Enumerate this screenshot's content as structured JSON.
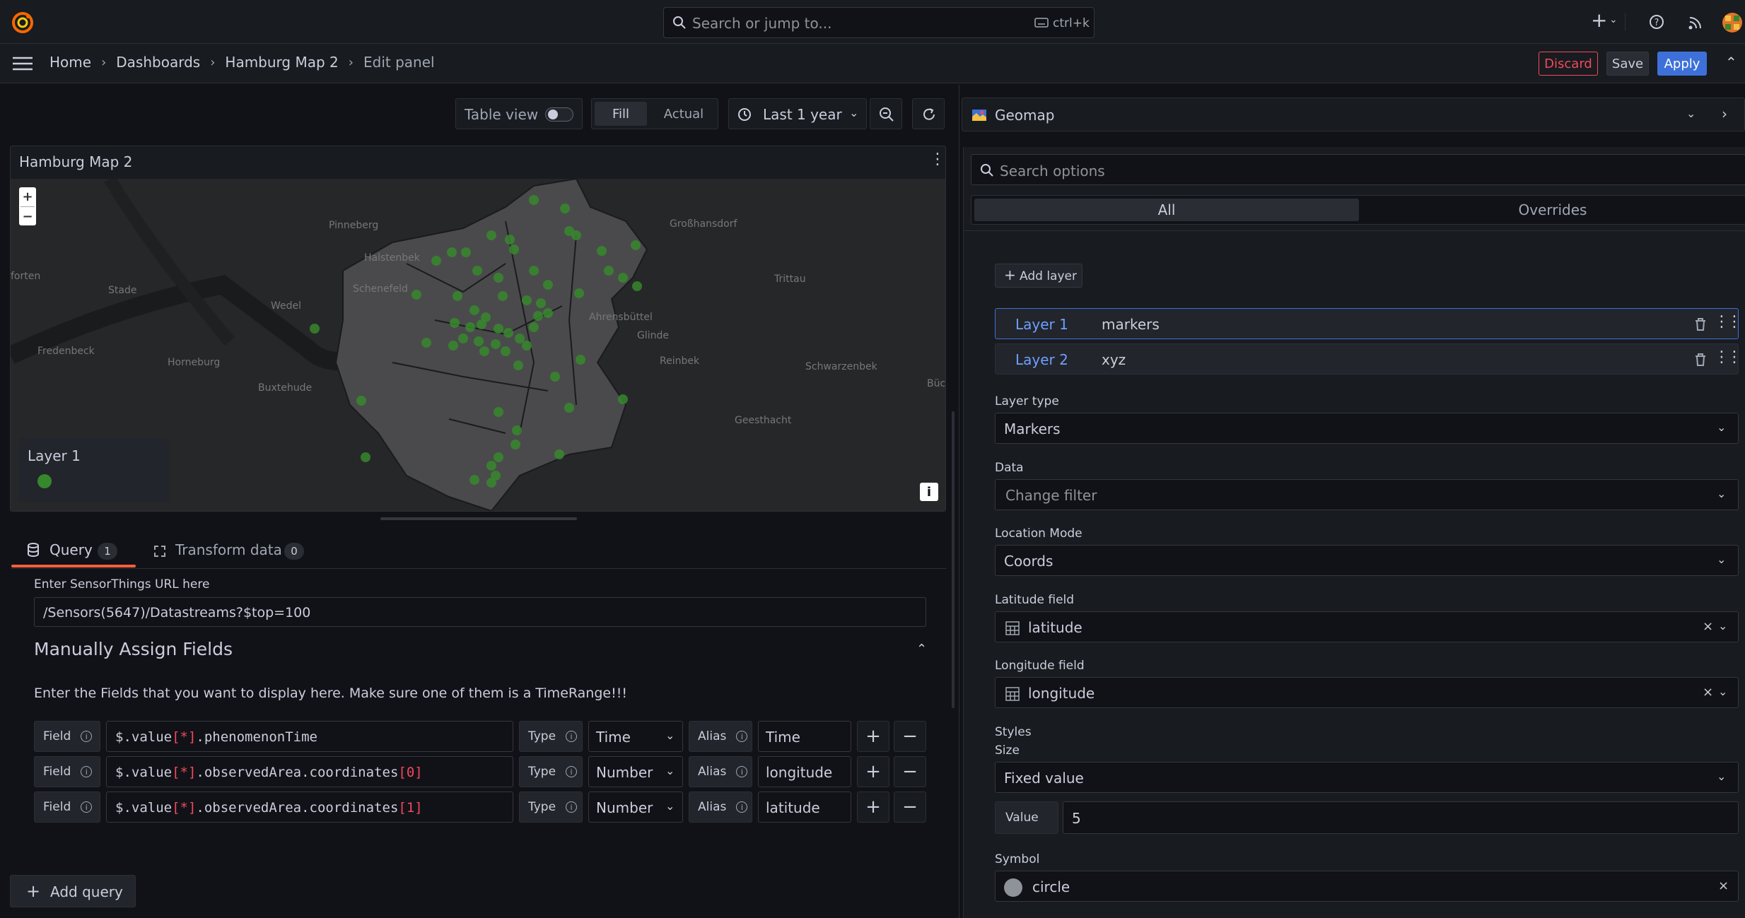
{
  "topbar": {
    "search_placeholder": "Search or jump to...",
    "search_shortcut": "ctrl+k"
  },
  "breadcrumb": {
    "items": [
      "Home",
      "Dashboards",
      "Hamburg Map 2",
      "Edit panel"
    ]
  },
  "actions": {
    "discard": "Discard",
    "save": "Save",
    "apply": "Apply"
  },
  "toolbar": {
    "table_view": "Table view",
    "fill": "Fill",
    "actual": "Actual",
    "time_range": "Last 1 year"
  },
  "panel": {
    "title": "Hamburg Map 2",
    "zoom_in": "+",
    "zoom_out": "−",
    "legend_title": "Layer 1",
    "info": "i",
    "places": [
      "Pinneberg",
      "Halstenbek",
      "Schenefeld",
      "Stade",
      "Wedel",
      "forten",
      "Großhansdorf",
      "Trittau",
      "Glinde",
      "Reinbek",
      "Schwarzenbek",
      "Buxtehude",
      "Horneburg",
      "Fredenbeck",
      "Geesthacht",
      "Bück",
      "Ahrensbüttel"
    ]
  },
  "query_tabs": {
    "query": "Query",
    "query_count": "1",
    "transform": "Transform data",
    "transform_count": "0"
  },
  "query": {
    "url_label": "Enter SensorThings URL here",
    "url_value": "/Sensors(5647)/Datastreams?$top=100",
    "section_title": "Manually Assign Fields",
    "instructions": "Enter the Fields that you want to display here. Make sure one of them is a TimeRange!!!",
    "field_label": "Field",
    "type_label": "Type",
    "alias_label": "Alias",
    "rows": [
      {
        "path_a": "$.value",
        "path_b": "[*]",
        "path_c": ".phenomenonTime",
        "path_d": "",
        "type": "Time",
        "alias": "Time"
      },
      {
        "path_a": "$.value",
        "path_b": "[*]",
        "path_c": ".observedArea.coordinates",
        "path_d": "[0]",
        "type": "Number",
        "alias": "longitude"
      },
      {
        "path_a": "$.value",
        "path_b": "[*]",
        "path_c": ".observedArea.coordinates",
        "path_d": "[1]",
        "type": "Number",
        "alias": "latitude"
      }
    ],
    "add_query": "Add query"
  },
  "options": {
    "viz": "Geomap",
    "search_placeholder": "Search options",
    "tab_all": "All",
    "tab_overrides": "Overrides",
    "add_layer": "Add layer",
    "layers": [
      {
        "name": "Layer 1",
        "type": "markers"
      },
      {
        "name": "Layer 2",
        "type": "xyz"
      }
    ],
    "layer_type_label": "Layer type",
    "layer_type_value": "Markers",
    "data_label": "Data",
    "data_placeholder": "Change filter",
    "location_mode_label": "Location Mode",
    "location_mode_value": "Coords",
    "latitude_label": "Latitude field",
    "latitude_value": "latitude",
    "longitude_label": "Longitude field",
    "longitude_value": "longitude",
    "styles_label": "Styles",
    "size_label": "Size",
    "size_mode": "Fixed value",
    "value_label": "Value",
    "value": "5",
    "symbol_label": "Symbol",
    "symbol_value": "circle"
  },
  "colors": {
    "accent_blue": "#3d71d9",
    "discard_red": "#f2495c",
    "marker_green": "#37872d",
    "tab_orange": "#f55f3e"
  }
}
